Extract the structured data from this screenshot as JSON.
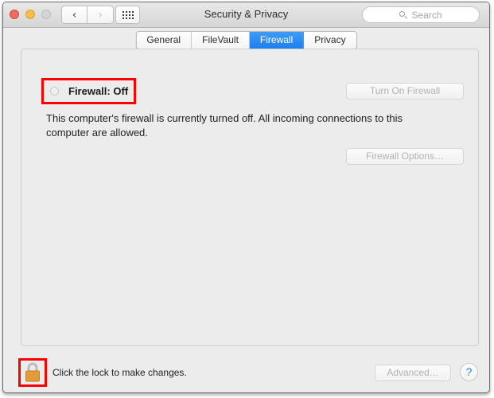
{
  "window": {
    "title": "Security & Privacy",
    "traffic_lights": [
      "close",
      "minimize",
      "zoom"
    ]
  },
  "toolbar": {
    "back_glyph": "‹",
    "forward_glyph": "›",
    "grid_icon": "show-all-icon",
    "search": {
      "placeholder": "Search",
      "value": "",
      "icon": "search-icon"
    }
  },
  "tabs": [
    {
      "label": "General",
      "active": false
    },
    {
      "label": "FileVault",
      "active": false
    },
    {
      "label": "Firewall",
      "active": true
    },
    {
      "label": "Privacy",
      "active": false
    }
  ],
  "firewall": {
    "status_label": "Firewall: Off",
    "status_indicator": "off",
    "description": "This computer's firewall is currently turned off. All incoming connections to this computer are allowed.",
    "turn_on_button": "Turn On Firewall",
    "options_button": "Firewall Options…",
    "turn_on_enabled": false,
    "options_enabled": false
  },
  "bottom": {
    "lock_icon": "locked-padlock-icon",
    "lock_state": "locked",
    "lock_text": "Click the lock to make changes.",
    "advanced_button": "Advanced…",
    "advanced_enabled": false,
    "help_button": "?"
  },
  "colors": {
    "accent_blue": "#1d7ff0",
    "highlight_red": "#ff0000",
    "lock_gold": "#e8a33d",
    "window_bg": "#ececec"
  }
}
